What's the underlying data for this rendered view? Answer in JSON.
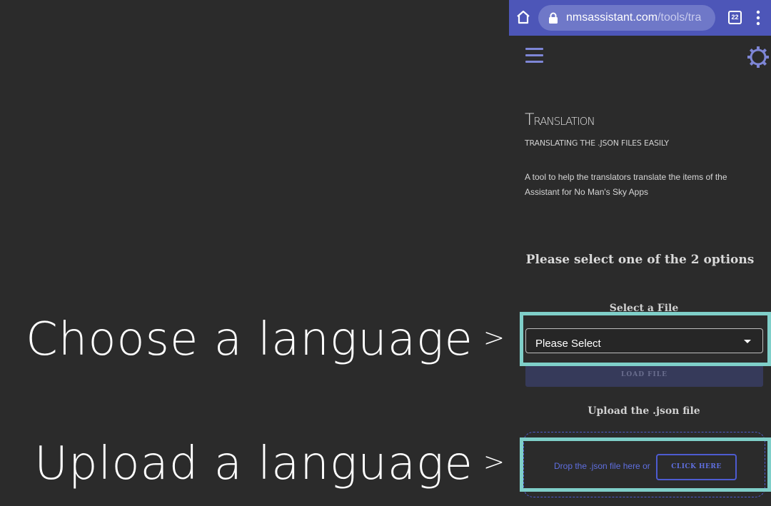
{
  "annotations": {
    "choose": "Choose a language",
    "upload": "Upload a language",
    "arrow": ">"
  },
  "browser": {
    "url_host": "nmsassistant.com",
    "url_path": "/tools/tra",
    "tab_count": "22"
  },
  "page": {
    "title": "Translation",
    "subtitle": "Translating the .json files easily",
    "description": "A tool to help the translators translate the items of the Assistant for No Man's Sky Apps",
    "options_heading": "Please select one of the 2 options",
    "select_file_label": "Select a File",
    "select_value": "Please Select",
    "load_button": "LOAD FILE",
    "upload_heading": "Upload the .json file",
    "drop_text": "Drop the .json file here or",
    "click_here": "CLICK HERE"
  },
  "colors": {
    "browser_bar": "#4d56b8",
    "accent": "#5f6fe0",
    "highlight": "#7fcfc9",
    "background": "#2b2b2b"
  },
  "icons": [
    "home-icon",
    "lock-icon",
    "tabs-icon",
    "overflow-menu-icon",
    "hamburger-icon",
    "gear-icon",
    "caret-down-icon"
  ]
}
